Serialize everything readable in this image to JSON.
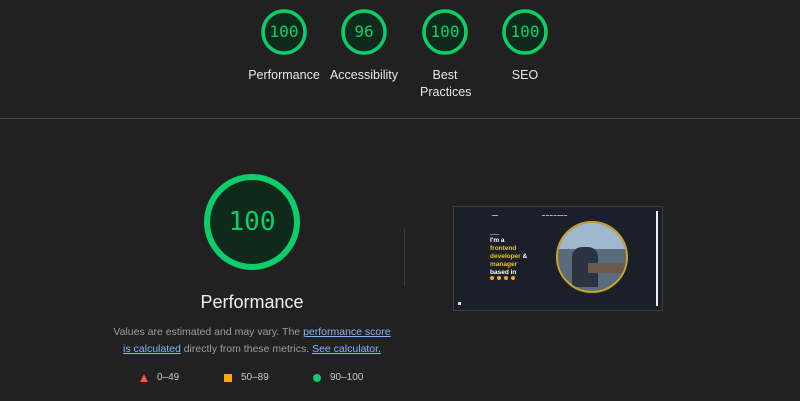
{
  "summary_gauges": [
    {
      "score": "100",
      "label": "Performance"
    },
    {
      "score": "96",
      "label": "Accessibility"
    },
    {
      "score": "100",
      "label": "Best Practices"
    },
    {
      "score": "100",
      "label": "SEO"
    }
  ],
  "performance": {
    "score": "100",
    "title": "Performance",
    "desc_before": "Values are estimated and may vary. The ",
    "link_score": "performance score is calculated",
    "desc_middle": " directly from these metrics. ",
    "link_calc": "See calculator."
  },
  "legend": [
    {
      "shape": "triangle-icon",
      "range": "0–49",
      "color": "#ff4e42"
    },
    {
      "shape": "square-icon",
      "range": "50–89",
      "color": "#ffa400"
    },
    {
      "shape": "circle-icon",
      "range": "90–100",
      "color": "#0cce6b"
    }
  ],
  "screenshot": {
    "hero_line1": "I'm a",
    "hero_line2": "frontend",
    "hero_line3a": "developer",
    "hero_line3b": " &",
    "hero_line4": "manager",
    "hero_line5": "based in"
  },
  "colors": {
    "pass": "#0cce6b",
    "average": "#ffa400",
    "fail": "#ff4e42"
  }
}
